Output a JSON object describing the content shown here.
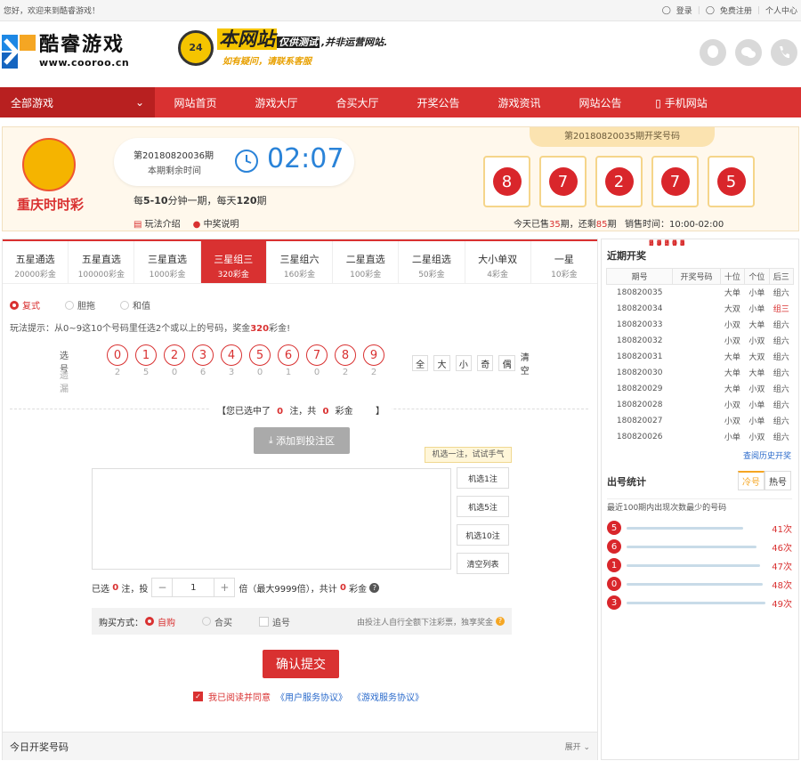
{
  "topbar": {
    "welcome": "您好，欢迎来到酷睿游戏！",
    "login": "登录",
    "register": "免费注册",
    "user_center": "个人中心"
  },
  "header": {
    "logo_title": "酷睿游戏",
    "logo_url": "www.cooroo.cn",
    "banner_main": "本网站",
    "banner_tag_hl": "仅供测试",
    "banner_tag": ",并非运营网站.",
    "banner_sub": "如有疑问，请联系客服",
    "banner_badge": "24"
  },
  "nav": {
    "all_games": "全部游戏",
    "items": [
      "网站首页",
      "游戏大厅",
      "合买大厅",
      "开奖公告",
      "游戏资讯",
      "网站公告",
      "手机网站"
    ]
  },
  "lottery": {
    "name": "重庆时时彩",
    "issue": "第20180820036期",
    "remain_label": "本期剩余时间",
    "countdown": "02:07",
    "period_a": "每",
    "period_b": "5-10",
    "period_c": "分钟一期，每天",
    "period_d": "120",
    "period_e": "期",
    "intro": "玩法介绍",
    "prize": "中奖说明",
    "prev_issue": "第20180820035期开奖号码",
    "prev_balls": [
      "8",
      "7",
      "2",
      "7",
      "5"
    ],
    "sold_a": "今天已售",
    "sold_b": "35",
    "sold_c": "期，还剩",
    "sold_d": "85",
    "sold_e": "期",
    "sale_time": "销售时间：10:00-02:00"
  },
  "play_tabs": [
    {
      "t": "五星通选",
      "s": "20000彩金"
    },
    {
      "t": "五星直选",
      "s": "100000彩金"
    },
    {
      "t": "三星直选",
      "s": "1000彩金"
    },
    {
      "t": "三星组三",
      "s": "320彩金"
    },
    {
      "t": "三星组六",
      "s": "160彩金"
    },
    {
      "t": "二星直选",
      "s": "100彩金"
    },
    {
      "t": "二星组选",
      "s": "50彩金"
    },
    {
      "t": "大小单双",
      "s": "4彩金"
    },
    {
      "t": "一星",
      "s": "10彩金"
    }
  ],
  "modes": [
    "复式",
    "胆拖",
    "和值"
  ],
  "tip_a": "玩法提示：从0~9这10个号码里任选2个或以上的号码，奖金",
  "tip_b": "320",
  "tip_c": "彩金!",
  "pick_label": "选号",
  "miss_label": "遗漏",
  "numbers": [
    "0",
    "1",
    "2",
    "3",
    "4",
    "5",
    "6",
    "7",
    "8",
    "9"
  ],
  "misses": [
    "2",
    "5",
    "0",
    "6",
    "3",
    "0",
    "1",
    "0",
    "2",
    "2"
  ],
  "filters": [
    "全",
    "大",
    "小",
    "奇",
    "偶",
    "清空"
  ],
  "selected_a": "【您已选中了",
  "selected_b": "0",
  "selected_c": "注，共",
  "selected_d": "0",
  "selected_e": "彩金",
  "selected_f": "】",
  "add_btn": "添加到投注区",
  "try_tip": "机选一注，试试手气",
  "side_btns": [
    "机选1注",
    "机选5注",
    "机选10注",
    "清空列表"
  ],
  "mult": {
    "a": "已选",
    "b": "0",
    "c": "注，投",
    "minus": "−",
    "val": "1",
    "plus": "+",
    "d": "倍（最大9999倍），共计",
    "e": "0",
    "f": "彩金"
  },
  "buy": {
    "label": "购买方式：",
    "self": "自购",
    "group": "合买",
    "chase": "追号",
    "note": "由投注人自行全额下注彩票，独享奖金"
  },
  "submit": "确认提交",
  "agree": {
    "text": "我已阅读并同意",
    "l1": "《用户服务协议》",
    "l2": "《游戏服务协议》"
  },
  "today": {
    "title": "今日开奖号码",
    "expand": "展开"
  },
  "recent": {
    "title": "近期开奖",
    "headers": [
      "期号",
      "开奖号码",
      "十位",
      "个位",
      "后三"
    ],
    "rows": [
      [
        "180820035",
        "87275",
        "大单",
        "小单",
        "组六"
      ],
      [
        "180820034",
        "14565",
        "大双",
        "小单",
        "组三"
      ],
      [
        "180820033",
        "99809",
        "小双",
        "大单",
        "组六"
      ],
      [
        "180820032",
        "66704",
        "小双",
        "小双",
        "组六"
      ],
      [
        "180820031",
        "38698",
        "大单",
        "大双",
        "组六"
      ],
      [
        "180820030",
        "17197",
        "大单",
        "大单",
        "组六"
      ],
      [
        "180820029",
        "74390",
        "大单",
        "小双",
        "组六"
      ],
      [
        "180820028",
        "28103",
        "小双",
        "小单",
        "组六"
      ],
      [
        "180820027",
        "27241",
        "小双",
        "小单",
        "组六"
      ],
      [
        "180820026",
        "89014",
        "小单",
        "小双",
        "组六"
      ]
    ],
    "history": "查阅历史开奖"
  },
  "stats": {
    "title": "出号统计",
    "tab_cold": "冷号",
    "tab_hot": "热号",
    "desc": "最近100期内出现次数最少的号码",
    "rows": [
      {
        "n": "5",
        "c": "41次",
        "v": 41
      },
      {
        "n": "6",
        "c": "46次",
        "v": 46
      },
      {
        "n": "1",
        "c": "47次",
        "v": 47
      },
      {
        "n": "0",
        "c": "48次",
        "v": 48
      },
      {
        "n": "3",
        "c": "49次",
        "v": 49
      }
    ]
  }
}
